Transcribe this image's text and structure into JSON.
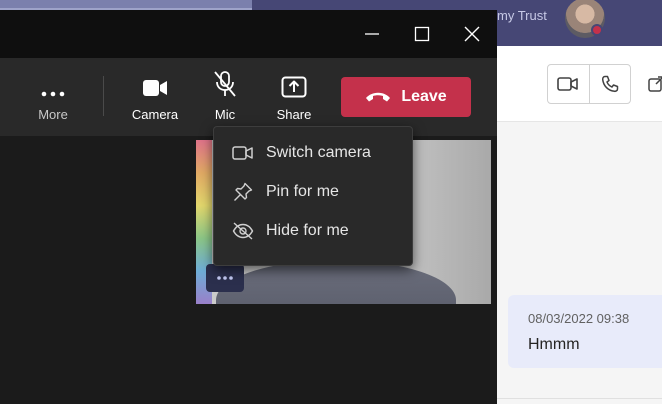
{
  "background_app": {
    "title_partial": "my Trust",
    "chat_message": {
      "timestamp": "08/03/2022 09:38",
      "text": "Hmmm"
    }
  },
  "meeting": {
    "toolbar": {
      "more_label": "More",
      "camera_label": "Camera",
      "mic_label": "Mic",
      "share_label": "Share",
      "leave_label": "Leave"
    },
    "context_menu": {
      "items": [
        {
          "label": "Switch camera",
          "icon": "video-camera-icon"
        },
        {
          "label": "Pin for me",
          "icon": "pin-icon"
        },
        {
          "label": "Hide for me",
          "icon": "eye-off-icon"
        }
      ]
    }
  },
  "colors": {
    "leave_red": "#c4314b",
    "teams_purple": "#464775",
    "chat_bubble": "#e8ebfa"
  }
}
